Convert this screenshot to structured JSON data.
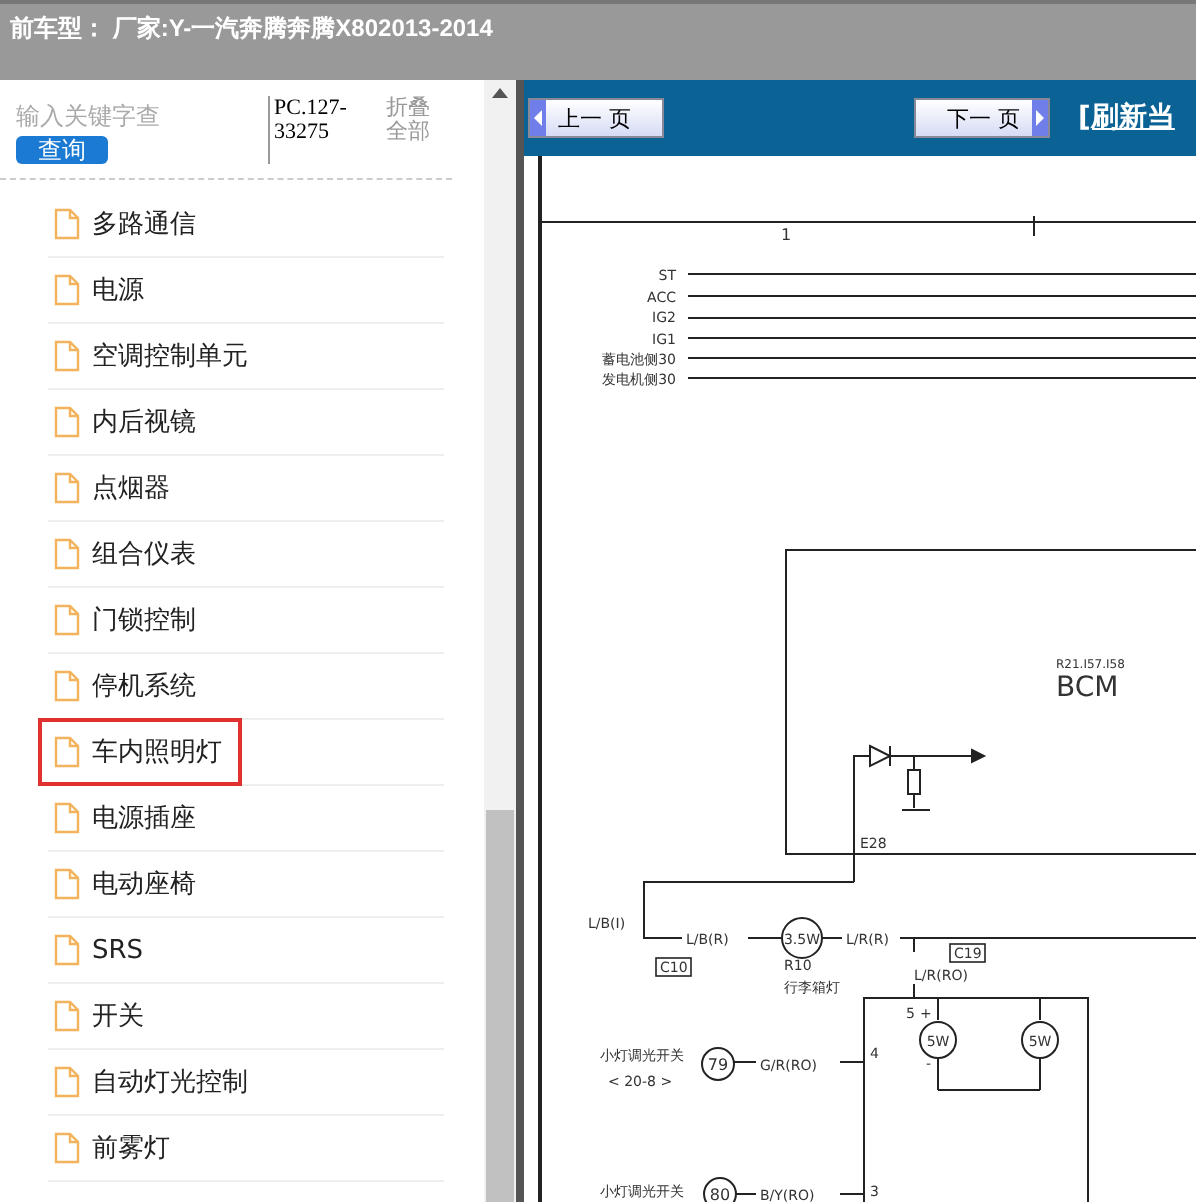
{
  "header": {
    "title": "前车型： 厂家:Y-一汽奔腾奔腾X802013-2014"
  },
  "sidebar": {
    "search": {
      "placeholder": "输入关键字查"
    },
    "search_button": "查询",
    "code": "PC.127-33275",
    "collapse_all": "折叠全部",
    "items": [
      {
        "label": "多路通信",
        "selected": false
      },
      {
        "label": "电源",
        "selected": false
      },
      {
        "label": "空调控制单元",
        "selected": false
      },
      {
        "label": "内后视镜",
        "selected": false
      },
      {
        "label": "点烟器",
        "selected": false
      },
      {
        "label": "组合仪表",
        "selected": false
      },
      {
        "label": "门锁控制",
        "selected": false
      },
      {
        "label": "停机系统",
        "selected": false
      },
      {
        "label": "车内照明灯",
        "selected": true
      },
      {
        "label": "电源插座",
        "selected": false
      },
      {
        "label": "电动座椅",
        "selected": false
      },
      {
        "label": "SRS",
        "selected": false
      },
      {
        "label": "开关",
        "selected": false
      },
      {
        "label": "自动灯光控制",
        "selected": false
      },
      {
        "label": "前雾灯",
        "selected": false
      }
    ]
  },
  "toolbar": {
    "prev_button": "上一 页",
    "next_button": "下一 页",
    "refresh_link": "[刷新当"
  },
  "diagram": {
    "labels": [
      {
        "text": "1",
        "kind": "plain"
      },
      {
        "text": "ST",
        "kind": "plain"
      },
      {
        "text": "ACC",
        "kind": "plain"
      },
      {
        "text": "IG2",
        "kind": "plain"
      },
      {
        "text": "IG1",
        "kind": "plain"
      },
      {
        "text": "蓄电池侧30",
        "kind": "plain"
      },
      {
        "text": "发电机侧30",
        "kind": "plain"
      },
      {
        "text": "R21.I57.I58",
        "kind": "plain"
      },
      {
        "text": "BCM",
        "kind": "title"
      },
      {
        "text": "E28",
        "kind": "plain"
      },
      {
        "text": "L/B(I)",
        "kind": "plain"
      },
      {
        "text": "L/B(R)",
        "kind": "plain"
      },
      {
        "text": "3.5W",
        "kind": "circled"
      },
      {
        "text": "L/R(R)",
        "kind": "plain"
      },
      {
        "text": "C10",
        "kind": "boxed"
      },
      {
        "text": "R10",
        "kind": "plain"
      },
      {
        "text": "行李箱灯",
        "kind": "plain"
      },
      {
        "text": "C19",
        "kind": "boxed"
      },
      {
        "text": "L/R(RO)",
        "kind": "plain"
      },
      {
        "text": "5",
        "kind": "plain"
      },
      {
        "text": "+",
        "kind": "plain"
      },
      {
        "text": "5W",
        "kind": "circled"
      },
      {
        "text": "-",
        "kind": "plain"
      },
      {
        "text": "5W",
        "kind": "circled"
      },
      {
        "text": "小灯调光开关",
        "kind": "plain"
      },
      {
        "text": "< 20-8 >",
        "kind": "plain"
      },
      {
        "text": "79",
        "kind": "circled"
      },
      {
        "text": "G/R(RO)",
        "kind": "plain"
      },
      {
        "text": "4",
        "kind": "plain"
      },
      {
        "text": "小灯调光开关",
        "kind": "plain"
      },
      {
        "text": "80",
        "kind": "circled"
      },
      {
        "text": "B/Y(RO)",
        "kind": "plain"
      },
      {
        "text": "3",
        "kind": "plain"
      }
    ]
  }
}
